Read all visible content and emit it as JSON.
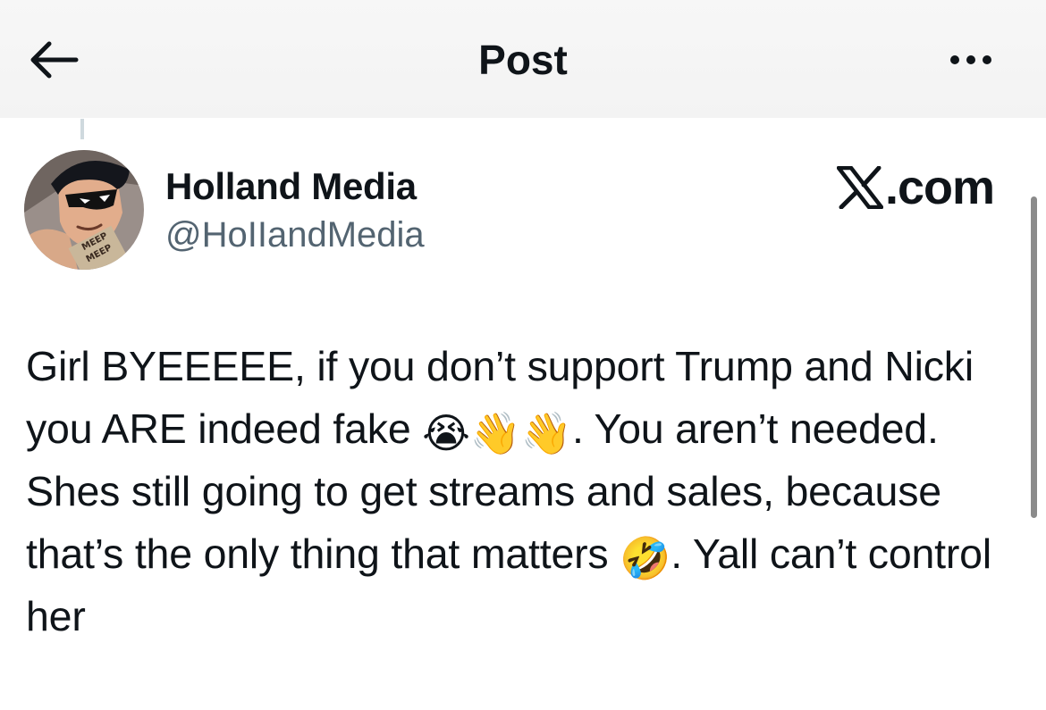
{
  "header": {
    "title": "Post",
    "back_icon": "arrow-left-icon",
    "more_icon": "more-horizontal-icon"
  },
  "author": {
    "display_name": "Holland Media",
    "handle": "@HoIIandMedia",
    "avatar_icon": "cartoon-avatar",
    "avatar_text": [
      "MEEP",
      "MEEP"
    ]
  },
  "watermark": {
    "logo_icon": "x-logo-icon",
    "suffix": ".com"
  },
  "tweet": {
    "segments": [
      "Girl BYEEEEE, if you don’t support Trump and Nicki you ARE indeed fake ",
      ". You aren’t needed. Shes still going to get streams and sales, because that’s the only thing that matters ",
      ". Yall can’t control her"
    ],
    "emojis": [
      "😭",
      "👋",
      "👋",
      "🤣"
    ]
  },
  "colors": {
    "text": "#0f1419",
    "secondary_text": "#536471",
    "header_bg": "#f5f5f5",
    "thread_line": "#cfd9de",
    "scrollbar": "#8b8b8b"
  }
}
